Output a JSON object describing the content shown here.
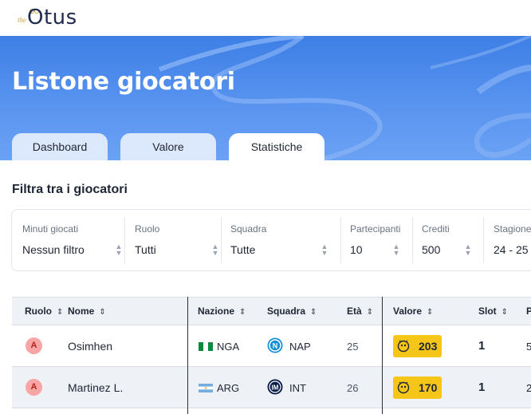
{
  "brand": {
    "prefix": "the",
    "name": "Otus"
  },
  "hero": {
    "title": "Listone giocatori"
  },
  "tabs": [
    {
      "label": "Dashboard"
    },
    {
      "label": "Valore"
    },
    {
      "label": "Statistiche",
      "active": true
    }
  ],
  "filters": {
    "title": "Filtra tra i giocatori",
    "items": [
      {
        "label": "Minuti giocati",
        "value": "Nessun filtro"
      },
      {
        "label": "Ruolo",
        "value": "Tutti"
      },
      {
        "label": "Squadra",
        "value": "Tutte"
      },
      {
        "label": "Partecipanti",
        "value": "10"
      },
      {
        "label": "Crediti",
        "value": "500"
      },
      {
        "label": "Stagione",
        "value": "24 - 25"
      }
    ]
  },
  "table": {
    "columns": [
      "Ruolo",
      "Nome",
      "Nazione",
      "Squadra",
      "Età",
      "Valore",
      "Slot",
      "P"
    ],
    "rows": [
      {
        "role": "A",
        "name": "Osimhen",
        "nation": "NGA",
        "team": "NAP",
        "age": "25",
        "value": "203",
        "slot": "1",
        "extra": "5"
      },
      {
        "role": "A",
        "name": "Martinez L.",
        "nation": "ARG",
        "team": "INT",
        "age": "26",
        "value": "170",
        "slot": "1",
        "extra": "2"
      }
    ]
  },
  "colors": {
    "hero_top": "#3d7fe6",
    "tab_bg": "#dce8fb",
    "role_attacker": "#f7a5a5",
    "value_pill": "#f5c518",
    "napoli": "#1a8fd6",
    "inter": "#0a1c4a"
  },
  "icons": [
    "owl-logo-icon",
    "sort-icon",
    "select-caret-icon",
    "nigeria-flag-icon",
    "argentina-flag-icon",
    "napoli-logo-icon",
    "inter-logo-icon",
    "coin-icon"
  ]
}
